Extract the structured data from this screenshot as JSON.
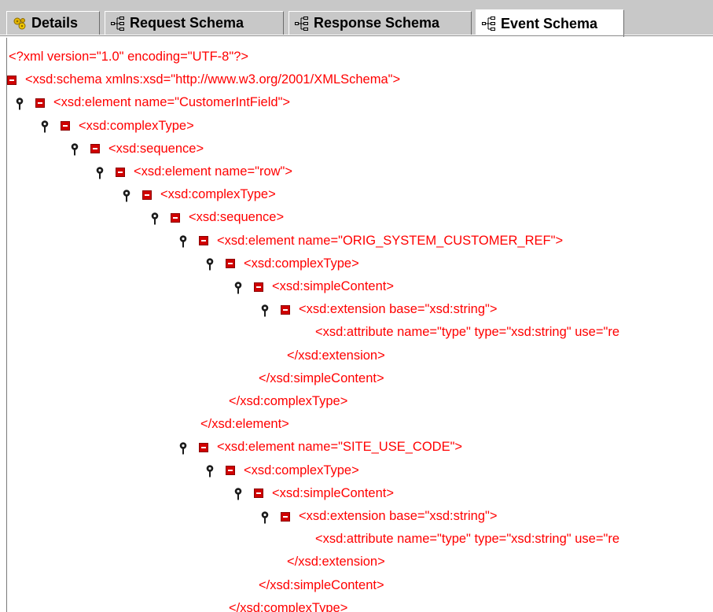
{
  "tabs": [
    {
      "label": "Details",
      "icon": "details-icon"
    },
    {
      "label": "Request Schema",
      "icon": "schema-tree-icon"
    },
    {
      "label": "Response Schema",
      "icon": "schema-tree-icon"
    },
    {
      "label": "Event Schema",
      "icon": "schema-tree-icon",
      "selected": true
    }
  ],
  "schema_lines": [
    {
      "text": "<?xml version=\"1.0\" encoding=\"UTF-8\"?>",
      "expander": false,
      "pin": false
    },
    {
      "text": "<xsd:schema xmlns:xsd=\"http://www.w3.org/2001/XMLSchema\">",
      "expander": true,
      "pin": false
    },
    {
      "text": "<xsd:element name=\"CustomerIntField\">",
      "expander": true,
      "pin": true
    },
    {
      "text": "<xsd:complexType>",
      "expander": true,
      "pin": true
    },
    {
      "text": "<xsd:sequence>",
      "expander": true,
      "pin": true
    },
    {
      "text": "<xsd:element name=\"row\">",
      "expander": true,
      "pin": true
    },
    {
      "text": "<xsd:complexType>",
      "expander": true,
      "pin": true
    },
    {
      "text": "<xsd:sequence>",
      "expander": true,
      "pin": true
    },
    {
      "text": "<xsd:element name=\"ORIG_SYSTEM_CUSTOMER_REF\">",
      "expander": true,
      "pin": true
    },
    {
      "text": "<xsd:complexType>",
      "expander": true,
      "pin": true
    },
    {
      "text": "<xsd:simpleContent>",
      "expander": true,
      "pin": true
    },
    {
      "text": "<xsd:extension base=\"xsd:string\">",
      "expander": true,
      "pin": true
    },
    {
      "text": "<xsd:attribute name=\"type\" type=\"xsd:string\" use=\"re",
      "expander": false,
      "pin": false
    },
    {
      "text": "</xsd:extension>",
      "expander": false,
      "pin": false
    },
    {
      "text": "</xsd:simpleContent>",
      "expander": false,
      "pin": false
    },
    {
      "text": "</xsd:complexType>",
      "expander": false,
      "pin": false
    },
    {
      "text": "</xsd:element>",
      "expander": false,
      "pin": false
    },
    {
      "text": "<xsd:element name=\"SITE_USE_CODE\">",
      "expander": true,
      "pin": true
    },
    {
      "text": "<xsd:complexType>",
      "expander": true,
      "pin": true
    },
    {
      "text": "<xsd:simpleContent>",
      "expander": true,
      "pin": true
    },
    {
      "text": "<xsd:extension base=\"xsd:string\">",
      "expander": true,
      "pin": true
    },
    {
      "text": "<xsd:attribute name=\"type\" type=\"xsd:string\" use=\"re",
      "expander": false,
      "pin": false
    },
    {
      "text": "</xsd:extension>",
      "expander": false,
      "pin": false
    },
    {
      "text": "</xsd:simpleContent>",
      "expander": false,
      "pin": false
    },
    {
      "text": "</xsd:complexType>",
      "expander": false,
      "pin": false
    }
  ],
  "colors": {
    "markup_text": "#ff0000",
    "expander": "#d00000"
  }
}
